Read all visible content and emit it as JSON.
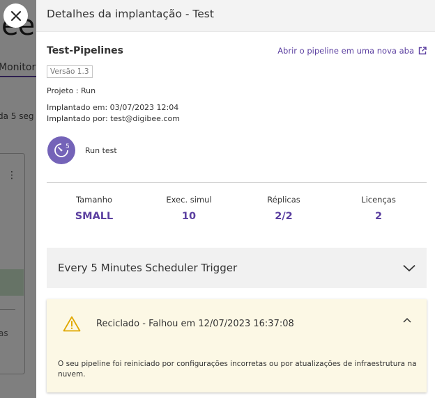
{
  "background": {
    "logo_fragment": "ee",
    "tab_fragment": "Monitor",
    "refresh_fragment": "da 5 seg",
    "menu_dots": "⋮",
    "list_fragment": "as"
  },
  "drawer": {
    "title": "Detalhes da implantação - Test",
    "pipeline_name": "Test-Pipelines",
    "open_link": "Abrir o pipeline em uma nova aba",
    "version": "Versão 1.3",
    "project": "Projeto : Run",
    "deployed_at": "Implantado em: 03/07/2023 12:04",
    "deployed_by": "Implantado por: test@digibee.com",
    "avatar_badge": "5",
    "run_label": "Run test"
  },
  "stats": [
    {
      "label": "Tamanho",
      "value": "SMALL"
    },
    {
      "label": "Exec. simul",
      "value": "10"
    },
    {
      "label": "Réplicas",
      "value": "2/2"
    },
    {
      "label": "Licenças",
      "value": "2"
    }
  ],
  "trigger": {
    "label": "Every 5 Minutes Scheduler Trigger"
  },
  "alert": {
    "title": "Reciclado - Falhou em 12/07/2023 16:37:08",
    "message": "O seu pipeline foi reiniciado por configurações incorretas ou por atualizações de infraestrutura na nuvem."
  },
  "colors": {
    "accent": "#5b3fa0",
    "avatar": "#7463b8",
    "alert_bg": "#fcf8e5",
    "warning": "#e0a800"
  },
  "icons": {
    "close": "close-icon",
    "external_link": "external-link-icon",
    "avatar": "timer-icon",
    "trigger_toggle": "chevron-down-icon",
    "alert_status": "warning-icon",
    "alert_toggle": "chevron-up-icon"
  }
}
